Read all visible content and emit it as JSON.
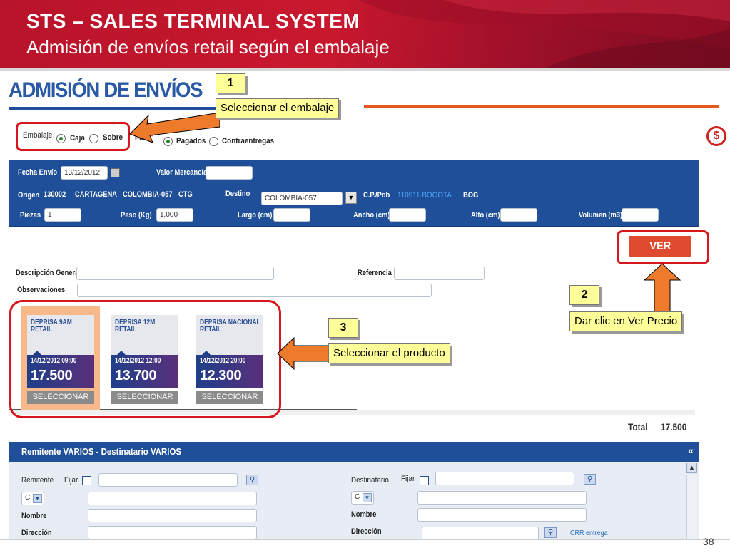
{
  "header": {
    "title": "STS – SALES  TERMINAL SYSTEM",
    "subtitle": "Admisión de envíos retail según el embalaje"
  },
  "app": {
    "heading": "ADMISIÓN DE ENVÍOS",
    "embalaje": {
      "label": "Embalaje",
      "options": [
        "Caja",
        "Sobre"
      ],
      "selected": "Caja"
    },
    "flete": {
      "label": "Flete",
      "required_mark": "*",
      "options": [
        "Pagados",
        "Contraentregas"
      ],
      "selected": "Pagados"
    },
    "form": {
      "fecha_envio_label": "Fecha Envío",
      "fecha_envio_value": "13/12/2012",
      "valor_mercancia_label": "Valor Mercancía",
      "valor_mercancia_value": "",
      "origen_label": "Origen",
      "origen_code": "130002",
      "origen_city": "CARTAGENA",
      "origen_country": "COLOMBIA-057",
      "origen_abbr": "CTG",
      "destino_label": "Destino",
      "destino_value": "COLOMBIA-057",
      "cp_label": "C.P./Pob",
      "cp_value": "110911 BOGOTA",
      "cp_abbr": "BOG",
      "piezas_label": "Piezas",
      "piezas_value": "1",
      "peso_label": "Peso (Kg)",
      "peso_value": "1,000",
      "largo_label": "Largo (cm)",
      "ancho_label": "Ancho (cm)",
      "alto_label": "Alto (cm)",
      "volumen_label": "Volumen (m3)"
    },
    "ver_precio": "VER PRECIO",
    "price_icon": "dollar-icon",
    "descripcion_label": "Descripción General",
    "referencia_label": "Referencia",
    "observaciones_label": "Observaciones",
    "products": [
      {
        "name": "DEPRISA 9AM RETAIL",
        "date": "14/12/2012 09:00",
        "price": "17.500",
        "button": "SELECCIONAR",
        "selected": true
      },
      {
        "name": "DEPRISA 12M RETAIL",
        "date": "14/12/2012 12:00",
        "price": "13.700",
        "button": "SELECCIONAR",
        "selected": false
      },
      {
        "name": "DEPRISA NACIONAL RETAIL",
        "date": "14/12/2012 20:00",
        "price": "12.300",
        "button": "SELECCIONAR",
        "selected": false
      }
    ],
    "total_label": "Total",
    "total_value": "17.500",
    "remitente_bar": "Remitente VARIOS - Destinatario VARIOS",
    "remitente": {
      "label": "Remitente",
      "fijar": "Fijar",
      "select_value": "C",
      "nombre": "Nombre",
      "direccion": "Dirección"
    },
    "destinatario": {
      "label": "Destinatario",
      "fijar": "Fijar",
      "select_value": "C",
      "nombre": "Nombre",
      "direccion": "Dirección",
      "crr": "CRR entrega"
    }
  },
  "callouts": [
    {
      "number": "1",
      "text": "Seleccionar el embalaje"
    },
    {
      "number": "2",
      "text": "Dar clic en Ver Precio"
    },
    {
      "number": "3",
      "text": "Seleccionar el producto"
    }
  ],
  "page_number": "38",
  "colors": {
    "brand_red": "#c8182e",
    "panel_blue": "#1f4f98",
    "callout_yellow": "#ffff99",
    "arrow_orange": "#ee7a2c",
    "highlight_red": "#d8161e"
  }
}
